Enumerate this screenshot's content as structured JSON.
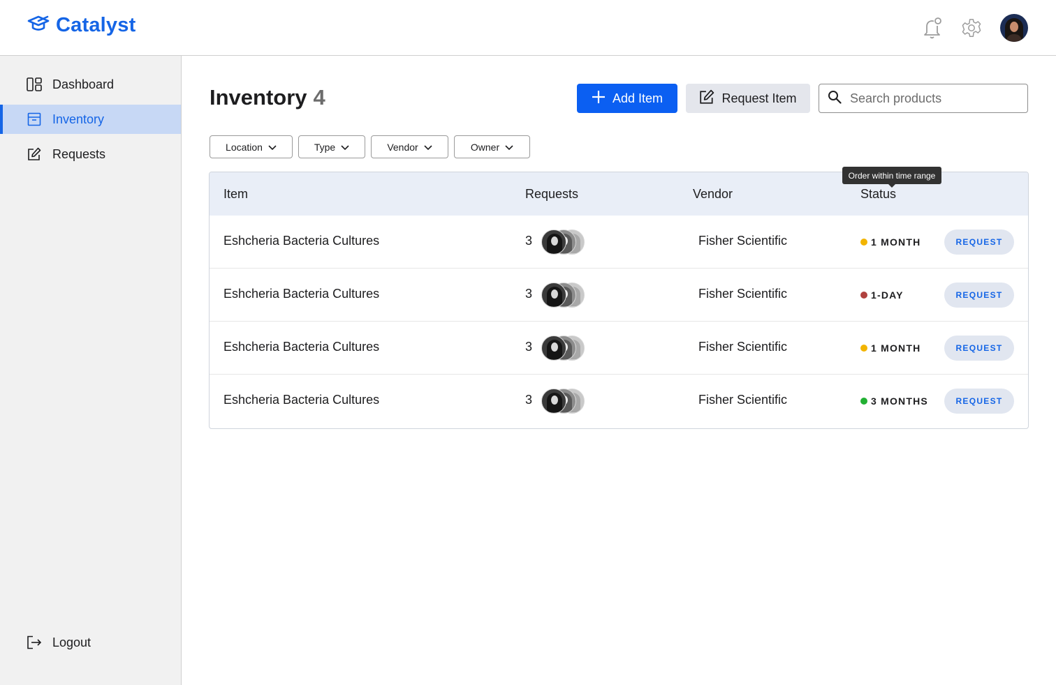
{
  "app": {
    "name": "Catalyst",
    "brand_color": "#1565e6",
    "primary_color": "#0b5ff2",
    "icons": [
      "graduation-cap-icon",
      "bell-icon",
      "gear-icon"
    ]
  },
  "sidebar": {
    "items": [
      {
        "label": "Dashboard",
        "icon": "dashboard-icon",
        "active": false
      },
      {
        "label": "Inventory",
        "icon": "archive-icon",
        "active": true
      },
      {
        "label": "Requests",
        "icon": "edit-icon",
        "active": false
      }
    ],
    "logout_label": "Logout"
  },
  "page": {
    "title": "Inventory",
    "count": "4"
  },
  "toolbar": {
    "add_label": "Add Item",
    "request_label": "Request Item",
    "search_placeholder": "Search products"
  },
  "filters": [
    "Location",
    "Type",
    "Vendor",
    "Owner"
  ],
  "table": {
    "headers": {
      "item": "Item",
      "requests": "Requests",
      "vendor": "Vendor",
      "status": "Status"
    },
    "status_tooltip": "Order within time range",
    "rows": [
      {
        "item": "Eshcheria Bacteria Cultures",
        "requests": "3",
        "vendor": "Fisher Scientific",
        "status": "1 MONTH",
        "status_color": "#f2b400",
        "action": "REQUEST"
      },
      {
        "item": "Eshcheria Bacteria Cultures",
        "requests": "3",
        "vendor": "Fisher Scientific",
        "status": "1-DAY",
        "status_color": "#b0413e",
        "action": "REQUEST"
      },
      {
        "item": "Eshcheria Bacteria Cultures",
        "requests": "3",
        "vendor": "Fisher Scientific",
        "status": "1 MONTH",
        "status_color": "#f2b400",
        "action": "REQUEST"
      },
      {
        "item": "Eshcheria Bacteria Cultures",
        "requests": "3",
        "vendor": "Fisher Scientific",
        "status": "3 MONTHS",
        "status_color": "#22b033",
        "action": "REQUEST"
      }
    ]
  }
}
